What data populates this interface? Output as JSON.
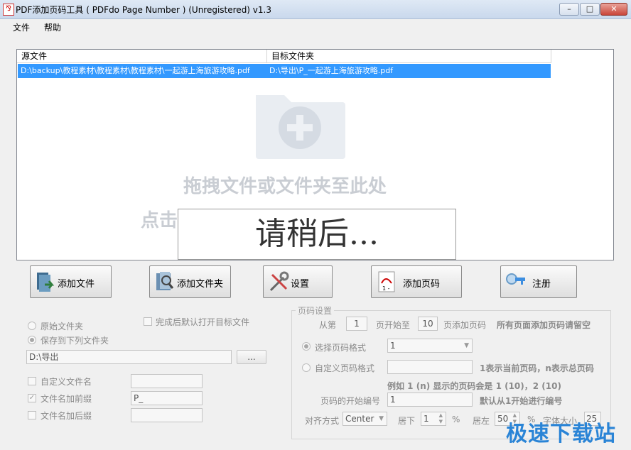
{
  "window": {
    "title": "PDF添加页码工具 ( PDFdo Page Number ) (Unregistered) v1.3"
  },
  "menu": {
    "file": "文件",
    "help": "帮助"
  },
  "list": {
    "col_source": "源文件",
    "col_target": "目标文件夹",
    "rows": [
      {
        "source": "D:\\backup\\教程素材\\教程素材\\教程素材\\一起游上海旅游攻略.pdf",
        "target": "D:\\导出\\P_一起游上海旅游攻略.pdf"
      }
    ],
    "drop_hint1": "拖拽文件或文件夹至此处",
    "drop_hint2": "点击",
    "loading": "请稍后..."
  },
  "toolbar": {
    "add_file": "添加文件",
    "add_folder": "添加文件夹",
    "settings": "设置",
    "add_page_number": "添加页码",
    "register": "注册"
  },
  "output": {
    "original_folder": "原始文件夹",
    "save_to_folder": "保存到下列文件夹",
    "open_after": "完成后默认打开目标文件",
    "folder_path": "D:\\导出",
    "browse": "...",
    "custom_name": "自定义文件名",
    "add_prefix": "文件名加前缀",
    "prefix_value": "P_",
    "add_suffix": "文件名加后缀"
  },
  "page_settings": {
    "title": "页码设置",
    "from": "从第",
    "from_value": "1",
    "start_at": "页开始至",
    "to_value": "10",
    "add_label": "页添加页码",
    "all_pages_hint": "所有页面添加页码请留空",
    "select_format": "选择页码格式",
    "format_value": "1",
    "custom_format": "自定义页码格式",
    "format_hint": "1表示当前页码，n表示总页码",
    "example": "例如 1 (n) 显示的页码会是 1 (10)，2 (10)",
    "start_number_label": "页码的开始编号",
    "start_number_value": "1",
    "start_number_hint": "默认从1开始进行编号",
    "align_label": "对齐方式",
    "align_value": "Center",
    "bottom_label": "居下",
    "bottom_value": "1",
    "percent1": "%",
    "left_label": "居左",
    "left_value": "50",
    "percent2": "%",
    "font_size_label": "字体大小",
    "font_size_value": "25"
  },
  "watermark": "极速下载站",
  "colors": {
    "selection": "#3399ff",
    "watermark": "#2a84d6"
  }
}
